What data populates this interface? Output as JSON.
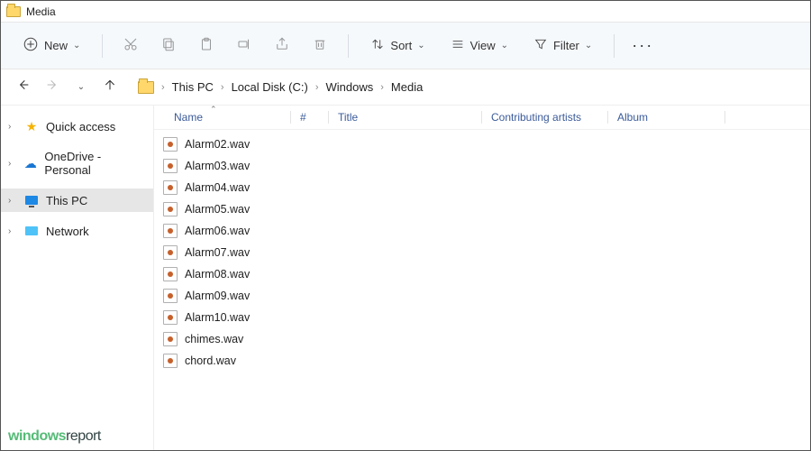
{
  "title": "Media",
  "toolbar": {
    "new_label": "New",
    "sort_label": "Sort",
    "view_label": "View",
    "filter_label": "Filter"
  },
  "breadcrumb": {
    "items": [
      "This PC",
      "Local Disk (C:)",
      "Windows",
      "Media"
    ]
  },
  "sidebar": {
    "items": [
      {
        "label": "Quick access"
      },
      {
        "label": "OneDrive - Personal"
      },
      {
        "label": "This PC"
      },
      {
        "label": "Network"
      }
    ]
  },
  "columns": {
    "name": "Name",
    "number": "#",
    "title": "Title",
    "artists": "Contributing artists",
    "album": "Album"
  },
  "files": [
    {
      "name": "Alarm02.wav"
    },
    {
      "name": "Alarm03.wav"
    },
    {
      "name": "Alarm04.wav"
    },
    {
      "name": "Alarm05.wav"
    },
    {
      "name": "Alarm06.wav"
    },
    {
      "name": "Alarm07.wav"
    },
    {
      "name": "Alarm08.wav"
    },
    {
      "name": "Alarm09.wav"
    },
    {
      "name": "Alarm10.wav"
    },
    {
      "name": "chimes.wav"
    },
    {
      "name": "chord.wav"
    }
  ],
  "logo": {
    "part1": "windows",
    "part2": "report"
  }
}
